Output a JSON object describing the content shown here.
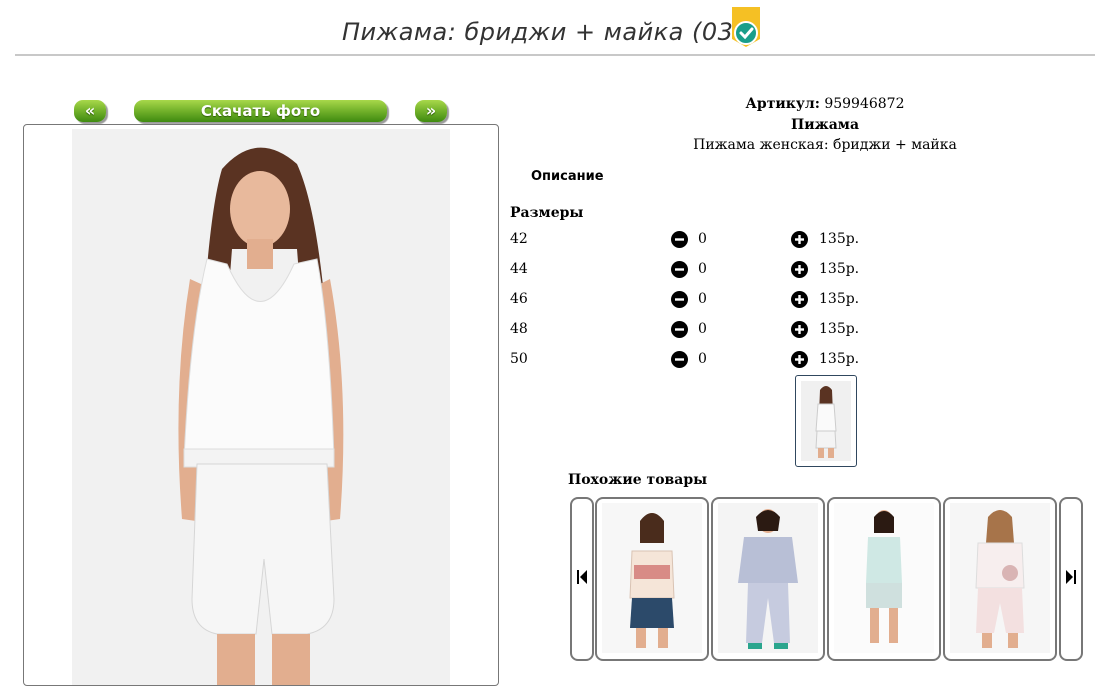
{
  "product": {
    "title": "Пижама: бриджи + майка (037)",
    "sku_label": "Артикул:",
    "sku_value": "959946872",
    "name": "Пижама",
    "short_desc": "Пижама женская: бриджи + майка"
  },
  "nav": {
    "prev_label": "«",
    "download_label": "Скачать фото",
    "next_label": "»"
  },
  "description_heading": "Описание",
  "sizes_heading": "Размеры",
  "sizes": [
    {
      "size": "42",
      "qty": "0",
      "price": "135р."
    },
    {
      "size": "44",
      "qty": "0",
      "price": "135р."
    },
    {
      "size": "46",
      "qty": "0",
      "price": "135р."
    },
    {
      "size": "48",
      "qty": "0",
      "price": "135р."
    },
    {
      "size": "50",
      "qty": "0",
      "price": "135р."
    }
  ],
  "similar_heading": "Похожие товары",
  "colors": {
    "accent_green": "#72b12a",
    "badge_yellow": "#f5c024",
    "badge_teal": "#1a9e8a"
  },
  "icons": [
    "check-badge-icon",
    "minus-circle-icon",
    "plus-circle-icon",
    "skip-prev-icon",
    "skip-next-icon"
  ]
}
